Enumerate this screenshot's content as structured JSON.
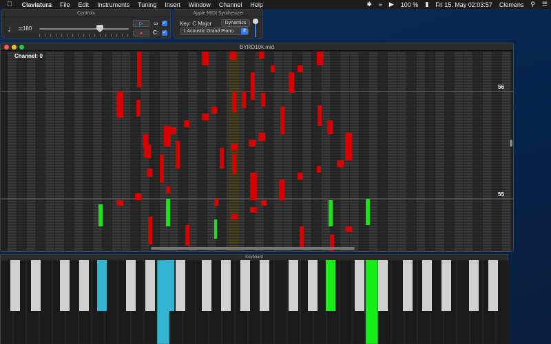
{
  "menubar": {
    "app_name": "Claviatura",
    "items": [
      "File",
      "Edit",
      "Instruments",
      "Tuning",
      "Insert",
      "Window",
      "Channel",
      "Help"
    ],
    "battery": "100 %",
    "datetime": "Fri 15. May  02:03:57",
    "user": "Clemens"
  },
  "controls_panel": {
    "title": "Controls",
    "tempo_value": "180",
    "c_label": "C:"
  },
  "synth_panel": {
    "title": "Apple MIDI Synthesizer",
    "key_label": "Key: C Major",
    "dynamics_label": "Dynamics",
    "instrument": "1 Acoustic Grand Piano"
  },
  "main_window": {
    "title": "BYRD10k.mid",
    "channel_label": "Channel: 0",
    "octave_labels": [
      "56",
      "55"
    ]
  },
  "keyboard_panel": {
    "title": "Keyboard"
  },
  "colors": {
    "accent": "#2f7cf6",
    "note_red": "#d60000",
    "note_green": "#18e418",
    "key_blue": "#34b4d0",
    "key_green": "#16ee16"
  }
}
